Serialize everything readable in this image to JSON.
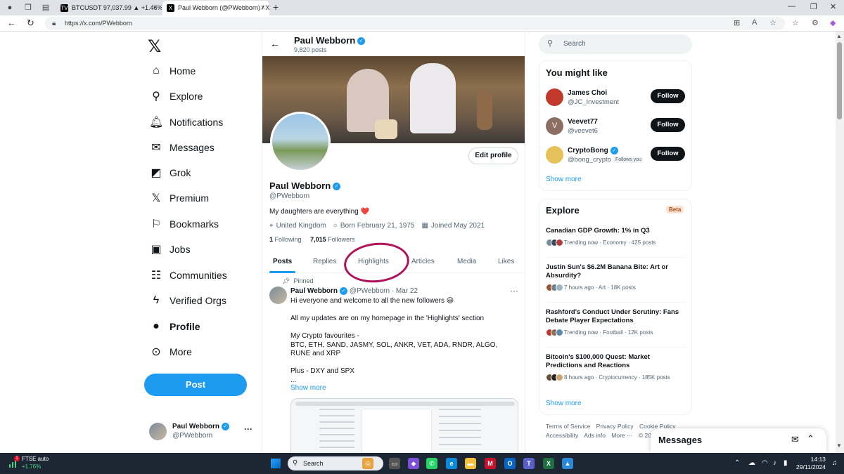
{
  "browser": {
    "tabs": [
      {
        "title": "BTCUSDT 97,037.99 ▲ +1.46% D",
        "favicon": "TV"
      },
      {
        "title": "Paul Webborn (@PWebborn) / X",
        "favicon": "X"
      }
    ],
    "url": "https://x.com/PWebborn"
  },
  "nav": {
    "logo": "𝕏",
    "items": [
      {
        "label": "Home",
        "icon": "home-icon",
        "glyph": "⌂"
      },
      {
        "label": "Explore",
        "icon": "search-icon",
        "glyph": "⚲"
      },
      {
        "label": "Notifications",
        "icon": "bell-icon",
        "glyph": "♫"
      },
      {
        "label": "Messages",
        "icon": "envelope-icon",
        "glyph": "✉"
      },
      {
        "label": "Grok",
        "icon": "grok-icon",
        "glyph": "◩"
      },
      {
        "label": "Premium",
        "icon": "x-premium-icon",
        "glyph": "𝕏"
      },
      {
        "label": "Bookmarks",
        "icon": "bookmark-icon",
        "glyph": "⚐"
      },
      {
        "label": "Jobs",
        "icon": "briefcase-icon",
        "glyph": "▣"
      },
      {
        "label": "Communities",
        "icon": "people-icon",
        "glyph": "☷"
      },
      {
        "label": "Verified Orgs",
        "icon": "lightning-icon",
        "glyph": "ϟ"
      },
      {
        "label": "Profile",
        "icon": "person-icon",
        "glyph": "●"
      },
      {
        "label": "More",
        "icon": "more-circle-icon",
        "glyph": "⊙"
      }
    ],
    "post_label": "Post",
    "account": {
      "name": "Paul Webborn",
      "handle": "@PWebborn",
      "more": "···"
    }
  },
  "profile": {
    "header_name": "Paul Webborn",
    "post_count": "9,820 posts",
    "edit_label": "Edit profile",
    "name": "Paul Webborn",
    "handle": "@PWebborn",
    "bio": "My daughters are everything",
    "bio_emoji": "❤️",
    "location": "United Kingdom",
    "born": "Born February 21, 1975",
    "joined": "Joined May 2021",
    "following_count": "1",
    "following_label": "Following",
    "followers_count": "7,015",
    "followers_label": "Followers",
    "tabs": [
      "Posts",
      "Replies",
      "Highlights",
      "Articles",
      "Media",
      "Likes"
    ],
    "active_tab": "Posts",
    "annotation_color": "#b0125b"
  },
  "pinned_tweet": {
    "pinned_label": "Pinned",
    "author": "Paul Webborn",
    "handle": "@PWebborn",
    "date": "· Mar 22",
    "lines": [
      "Hi everyone and welcome to all the new followers 😃",
      "",
      "All my updates are on my homepage in the 'Highlights' section",
      "",
      "My Crypto favourites -",
      "BTC, ETH, SAND, JASMY, SOL, ANKR, VET, ADA, RNDR, ALGO, RUNE and XRP",
      "",
      "Plus - DXY and SPX",
      "..."
    ],
    "show_more": "Show more"
  },
  "right": {
    "search_placeholder": "Search",
    "you_might_like": {
      "title": "You might like",
      "users": [
        {
          "name": "James Choi",
          "handle": "@JC_Investment",
          "follow": "Follow",
          "avatar_color": "#c0392b",
          "avatar_letter": ""
        },
        {
          "name": "Veevet77",
          "handle": "@veevet6",
          "follow": "Follow",
          "avatar_color": "#8d6e63",
          "avatar_letter": "V"
        },
        {
          "name": "CryptoBong",
          "handle": "@bong_crypto",
          "follows_you": "Follows you",
          "follow": "Follow",
          "avatar_color": "#e6c15a",
          "avatar_letter": ""
        }
      ],
      "show_more": "Show more"
    },
    "explore": {
      "title": "Explore",
      "beta": "Beta",
      "trends": [
        {
          "title": "Canadian GDP Growth: 1% in Q3",
          "meta": "Trending now · Economy · 425 posts"
        },
        {
          "title": "Justin Sun's $6.2M Banana Bite: Art or Absurdity?",
          "meta": "7 hours ago · Art · 18K posts"
        },
        {
          "title": "Rashford's Conduct Under Scrutiny: Fans Debate Player Expectations",
          "meta": "Trending now · Football · 12K posts"
        },
        {
          "title": "Bitcoin's $100,000 Quest: Market Predictions and Reactions",
          "meta": "8 hours ago · Cryptocurrency · 185K posts"
        }
      ],
      "show_more": "Show more"
    },
    "footer": [
      "Terms of Service",
      "Privacy Policy",
      "Cookie Policy",
      "Accessibility",
      "Ads info",
      "More ···",
      "© 20"
    ]
  },
  "messages_drawer": {
    "title": "Messages"
  },
  "taskbar": {
    "ticker": "FTSE auto",
    "ticker_change": "+1.76%",
    "search_placeholder": "Search",
    "time": "14:13",
    "date": "29/11/2024"
  },
  "colors": {
    "accent": "#1d9bf0",
    "text": "#0f1419",
    "muted": "#536471"
  }
}
